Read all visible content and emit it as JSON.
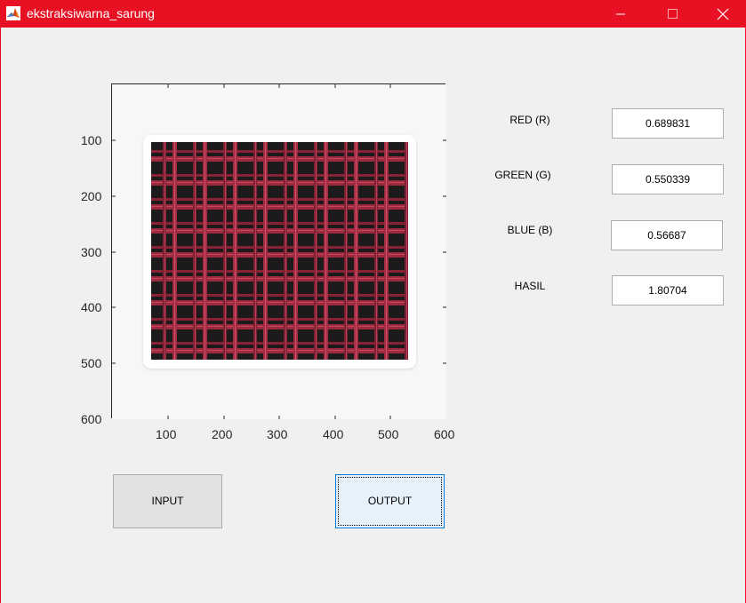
{
  "window": {
    "title": "ekstraksiwarna_sarung",
    "accent_color": "#e81123",
    "icons": [
      "matlab-logo-icon",
      "minimize-icon",
      "maximize-icon",
      "close-icon"
    ]
  },
  "axes": {
    "x_ticks": [
      "100",
      "200",
      "300",
      "400",
      "500",
      "600"
    ],
    "y_ticks": [
      "100",
      "200",
      "300",
      "400",
      "500",
      "600"
    ],
    "x_range": [
      0,
      600
    ],
    "y_range": [
      0,
      600
    ],
    "image_description": "red and black plaid sarung fabric"
  },
  "fields": {
    "red": {
      "label": "RED (R)",
      "value": "0.689831"
    },
    "green": {
      "label": "GREEN (G)",
      "value": "0.550339"
    },
    "blue": {
      "label": "BLUE (B)",
      "value": "0.56687"
    },
    "hasil": {
      "label": "HASIL",
      "value": "1.80704"
    }
  },
  "buttons": {
    "input": "INPUT",
    "output": "OUTPUT"
  }
}
